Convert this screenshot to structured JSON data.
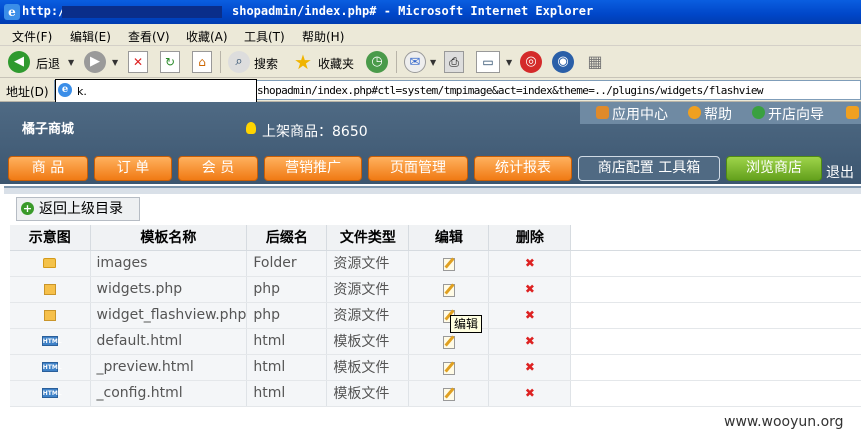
{
  "window": {
    "title_prefix": "http://",
    "title_suffix": "shopadmin/index.php# - Microsoft Internet Explorer"
  },
  "menubar": {
    "items": [
      "文件(F)",
      "编辑(E)",
      "查看(V)",
      "收藏(A)",
      "工具(T)",
      "帮助(H)"
    ]
  },
  "toolbar": {
    "back_label": "后退",
    "search_label": "搜索",
    "favorites_label": "收藏夹"
  },
  "address": {
    "label": "地址(D)",
    "prefix": "k.",
    "url": "shopadmin/index.php#ctl=system/tmpimage&act=index&theme=../plugins/widgets/flashview"
  },
  "header": {
    "shop_name": "橘子商城",
    "products_label": "上架商品：8650",
    "links": [
      "应用中心",
      "帮助",
      "开店向导"
    ]
  },
  "nav": {
    "tabs": [
      "商 品",
      "订 单",
      "会 员",
      "营销推广",
      "页面管理",
      "统计报表",
      "商店配置  工具箱",
      "浏览商店"
    ],
    "logout": "退出"
  },
  "content": {
    "back_button": "返回上级目录",
    "columns": [
      "示意图",
      "模板名称",
      "后缀名",
      "文件类型",
      "编辑",
      "删除"
    ],
    "rows": [
      {
        "icon": "folder-icon",
        "name": "images",
        "ext": "Folder",
        "type": "资源文件"
      },
      {
        "icon": "image-file-icon",
        "name": "widgets.php",
        "ext": "php",
        "type": "资源文件"
      },
      {
        "icon": "image-file-icon",
        "name": "widget_flashview.php",
        "ext": "php",
        "type": "资源文件"
      },
      {
        "icon": "html-file-icon",
        "name": "default.html",
        "ext": "html",
        "type": "模板文件"
      },
      {
        "icon": "html-file-icon",
        "name": "_preview.html",
        "ext": "html",
        "type": "模板文件"
      },
      {
        "icon": "html-file-icon",
        "name": "_config.html",
        "ext": "html",
        "type": "模板文件"
      }
    ],
    "tooltip": "编辑"
  },
  "watermark": "www.wooyun.org",
  "colors": {
    "nav_orange": "#f07a14",
    "nav_green": "#63a01c",
    "header_bg": "#4f6a84",
    "delete_red": "#dd2222"
  }
}
